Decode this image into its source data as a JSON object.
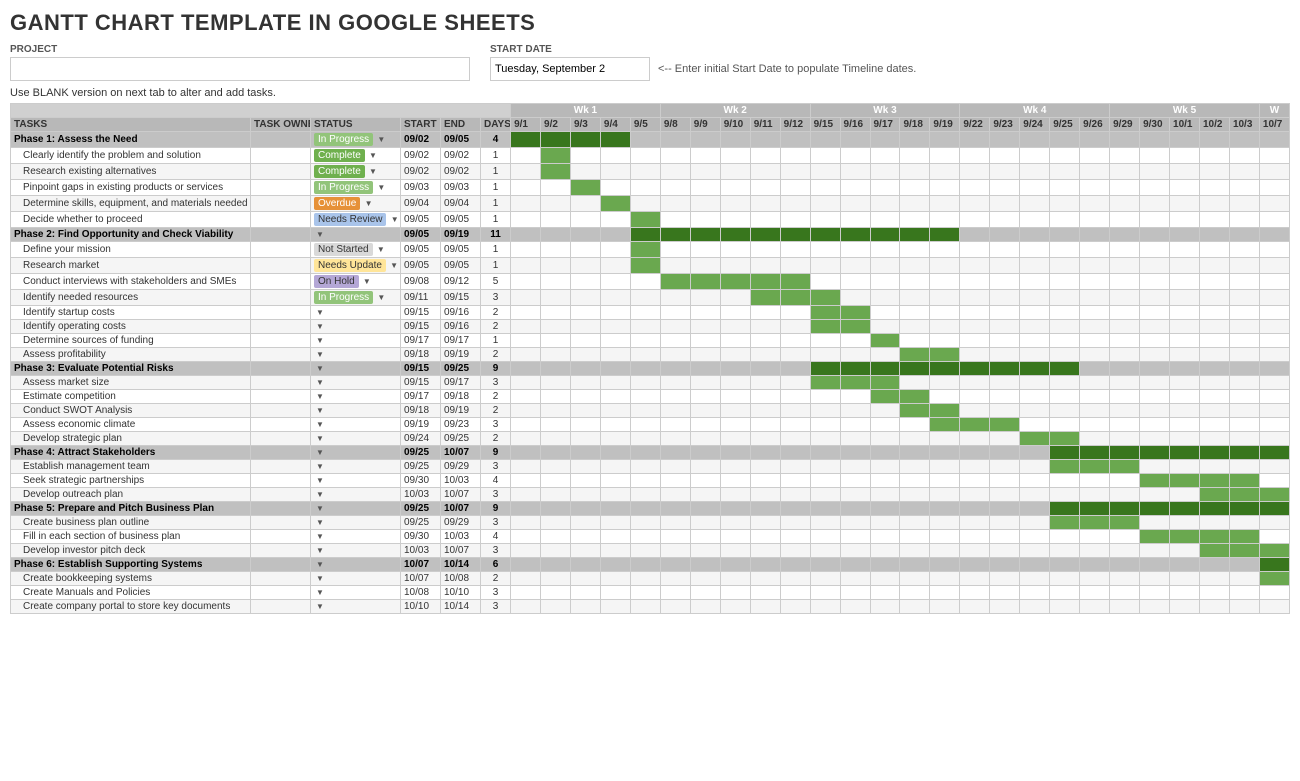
{
  "title": "GANTT CHART TEMPLATE IN GOOGLE SHEETS",
  "project_label": "PROJECT",
  "project_value": "",
  "start_date_label": "START DATE",
  "start_date_value": "Tuesday, September 2",
  "start_date_hint": "<-- Enter initial Start Date to populate Timeline dates.",
  "blank_note": "Use BLANK version on next tab to alter and add tasks.",
  "col_headers": {
    "tasks": "TASKS",
    "task_owner": "TASK OWNER",
    "status": "STATUS",
    "start": "START",
    "end": "END",
    "days": "DAYS"
  },
  "weeks": [
    "Wk 1",
    "Wk 2",
    "Wk 3",
    "Wk 4",
    "Wk 5",
    "W"
  ],
  "days": [
    "9/1",
    "9/2",
    "9/3",
    "9/4",
    "9/5",
    "9/8",
    "9/9",
    "9/10",
    "9/11",
    "9/12",
    "9/15",
    "9/16",
    "9/17",
    "9/18",
    "9/19",
    "9/22",
    "9/23",
    "9/24",
    "9/25",
    "9/26",
    "9/29",
    "9/30",
    "10/1",
    "10/2",
    "10/3",
    "10/7"
  ],
  "rows": [
    {
      "type": "phase",
      "task": "Phase 1: Assess the Need",
      "owner": "",
      "status": "In Progress",
      "status_class": "status-in-progress",
      "start": "09/02",
      "end": "09/05",
      "days": "4",
      "bars": [
        1,
        1,
        1,
        1,
        0,
        0,
        0,
        0,
        0,
        0,
        0,
        0,
        0,
        0,
        0,
        0,
        0,
        0,
        0,
        0,
        0,
        0,
        0,
        0,
        0,
        0
      ]
    },
    {
      "type": "task",
      "task": "Clearly identify the problem and solution",
      "owner": "",
      "status": "Complete",
      "status_class": "status-complete",
      "start": "09/02",
      "end": "09/02",
      "days": "1",
      "bars": [
        0,
        1,
        0,
        0,
        0,
        0,
        0,
        0,
        0,
        0,
        0,
        0,
        0,
        0,
        0,
        0,
        0,
        0,
        0,
        0,
        0,
        0,
        0,
        0,
        0,
        0
      ]
    },
    {
      "type": "task",
      "task": "Research existing alternatives",
      "owner": "",
      "status": "Complete",
      "status_class": "status-complete",
      "start": "09/02",
      "end": "09/02",
      "days": "1",
      "bars": [
        0,
        1,
        0,
        0,
        0,
        0,
        0,
        0,
        0,
        0,
        0,
        0,
        0,
        0,
        0,
        0,
        0,
        0,
        0,
        0,
        0,
        0,
        0,
        0,
        0,
        0
      ]
    },
    {
      "type": "task",
      "task": "Pinpoint gaps in existing products or services",
      "owner": "",
      "status": "In Progress",
      "status_class": "status-in-progress",
      "start": "09/03",
      "end": "09/03",
      "days": "1",
      "bars": [
        0,
        0,
        1,
        0,
        0,
        0,
        0,
        0,
        0,
        0,
        0,
        0,
        0,
        0,
        0,
        0,
        0,
        0,
        0,
        0,
        0,
        0,
        0,
        0,
        0,
        0
      ]
    },
    {
      "type": "task",
      "task": "Determine skills, equipment, and materials needed",
      "owner": "",
      "status": "Overdue",
      "status_class": "status-overdue",
      "start": "09/04",
      "end": "09/04",
      "days": "1",
      "bars": [
        0,
        0,
        0,
        1,
        0,
        0,
        0,
        0,
        0,
        0,
        0,
        0,
        0,
        0,
        0,
        0,
        0,
        0,
        0,
        0,
        0,
        0,
        0,
        0,
        0,
        0
      ]
    },
    {
      "type": "task",
      "task": "Decide whether to proceed",
      "owner": "",
      "status": "Needs Review",
      "status_class": "status-needs-review",
      "start": "09/05",
      "end": "09/05",
      "days": "1",
      "bars": [
        0,
        0,
        0,
        0,
        1,
        0,
        0,
        0,
        0,
        0,
        0,
        0,
        0,
        0,
        0,
        0,
        0,
        0,
        0,
        0,
        0,
        0,
        0,
        0,
        0,
        0
      ]
    },
    {
      "type": "phase",
      "task": "Phase 2: Find Opportunity and Check Viability",
      "owner": "",
      "status": "",
      "status_class": "",
      "start": "09/05",
      "end": "09/19",
      "days": "11",
      "bars": [
        0,
        0,
        0,
        0,
        1,
        1,
        1,
        1,
        1,
        1,
        1,
        1,
        1,
        1,
        1,
        0,
        0,
        0,
        0,
        0,
        0,
        0,
        0,
        0,
        0,
        0
      ]
    },
    {
      "type": "task",
      "task": "Define your mission",
      "owner": "",
      "status": "Not Started",
      "status_class": "status-not-started",
      "start": "09/05",
      "end": "09/05",
      "days": "1",
      "bars": [
        0,
        0,
        0,
        0,
        1,
        0,
        0,
        0,
        0,
        0,
        0,
        0,
        0,
        0,
        0,
        0,
        0,
        0,
        0,
        0,
        0,
        0,
        0,
        0,
        0,
        0
      ]
    },
    {
      "type": "task",
      "task": "Research market",
      "owner": "",
      "status": "Needs Update",
      "status_class": "status-needs-update",
      "start": "09/05",
      "end": "09/05",
      "days": "1",
      "bars": [
        0,
        0,
        0,
        0,
        1,
        0,
        0,
        0,
        0,
        0,
        0,
        0,
        0,
        0,
        0,
        0,
        0,
        0,
        0,
        0,
        0,
        0,
        0,
        0,
        0,
        0
      ]
    },
    {
      "type": "task",
      "task": "Conduct interviews with stakeholders and SMEs",
      "owner": "",
      "status": "On Hold",
      "status_class": "status-on-hold",
      "start": "09/08",
      "end": "09/12",
      "days": "5",
      "bars": [
        0,
        0,
        0,
        0,
        0,
        1,
        1,
        1,
        1,
        1,
        0,
        0,
        0,
        0,
        0,
        0,
        0,
        0,
        0,
        0,
        0,
        0,
        0,
        0,
        0,
        0
      ]
    },
    {
      "type": "task",
      "task": "Identify needed resources",
      "owner": "",
      "status": "In Progress",
      "status_class": "status-in-progress",
      "start": "09/11",
      "end": "09/15",
      "days": "3",
      "bars": [
        0,
        0,
        0,
        0,
        0,
        0,
        0,
        0,
        1,
        1,
        1,
        0,
        0,
        0,
        0,
        0,
        0,
        0,
        0,
        0,
        0,
        0,
        0,
        0,
        0,
        0
      ]
    },
    {
      "type": "task",
      "task": "Identify startup costs",
      "owner": "",
      "status": "",
      "status_class": "",
      "start": "09/15",
      "end": "09/16",
      "days": "2",
      "bars": [
        0,
        0,
        0,
        0,
        0,
        0,
        0,
        0,
        0,
        0,
        1,
        1,
        0,
        0,
        0,
        0,
        0,
        0,
        0,
        0,
        0,
        0,
        0,
        0,
        0,
        0
      ]
    },
    {
      "type": "task",
      "task": "Identify operating costs",
      "owner": "",
      "status": "",
      "status_class": "",
      "start": "09/15",
      "end": "09/16",
      "days": "2",
      "bars": [
        0,
        0,
        0,
        0,
        0,
        0,
        0,
        0,
        0,
        0,
        1,
        1,
        0,
        0,
        0,
        0,
        0,
        0,
        0,
        0,
        0,
        0,
        0,
        0,
        0,
        0
      ]
    },
    {
      "type": "task",
      "task": "Determine sources of funding",
      "owner": "",
      "status": "",
      "status_class": "",
      "start": "09/17",
      "end": "09/17",
      "days": "1",
      "bars": [
        0,
        0,
        0,
        0,
        0,
        0,
        0,
        0,
        0,
        0,
        0,
        0,
        1,
        0,
        0,
        0,
        0,
        0,
        0,
        0,
        0,
        0,
        0,
        0,
        0,
        0
      ]
    },
    {
      "type": "task",
      "task": "Assess profitability",
      "owner": "",
      "status": "",
      "status_class": "",
      "start": "09/18",
      "end": "09/19",
      "days": "2",
      "bars": [
        0,
        0,
        0,
        0,
        0,
        0,
        0,
        0,
        0,
        0,
        0,
        0,
        0,
        1,
        1,
        0,
        0,
        0,
        0,
        0,
        0,
        0,
        0,
        0,
        0,
        0
      ]
    },
    {
      "type": "phase",
      "task": "Phase 3: Evaluate Potential Risks",
      "owner": "",
      "status": "",
      "status_class": "",
      "start": "09/15",
      "end": "09/25",
      "days": "9",
      "bars": [
        0,
        0,
        0,
        0,
        0,
        0,
        0,
        0,
        0,
        0,
        1,
        1,
        1,
        1,
        1,
        1,
        1,
        1,
        1,
        0,
        0,
        0,
        0,
        0,
        0,
        0
      ]
    },
    {
      "type": "task",
      "task": "Assess market size",
      "owner": "",
      "status": "",
      "status_class": "",
      "start": "09/15",
      "end": "09/17",
      "days": "3",
      "bars": [
        0,
        0,
        0,
        0,
        0,
        0,
        0,
        0,
        0,
        0,
        1,
        1,
        1,
        0,
        0,
        0,
        0,
        0,
        0,
        0,
        0,
        0,
        0,
        0,
        0,
        0
      ]
    },
    {
      "type": "task",
      "task": "Estimate competition",
      "owner": "",
      "status": "",
      "status_class": "",
      "start": "09/17",
      "end": "09/18",
      "days": "2",
      "bars": [
        0,
        0,
        0,
        0,
        0,
        0,
        0,
        0,
        0,
        0,
        0,
        0,
        1,
        1,
        0,
        0,
        0,
        0,
        0,
        0,
        0,
        0,
        0,
        0,
        0,
        0
      ]
    },
    {
      "type": "task",
      "task": "Conduct SWOT Analysis",
      "owner": "",
      "status": "",
      "status_class": "",
      "start": "09/18",
      "end": "09/19",
      "days": "2",
      "bars": [
        0,
        0,
        0,
        0,
        0,
        0,
        0,
        0,
        0,
        0,
        0,
        0,
        0,
        1,
        1,
        0,
        0,
        0,
        0,
        0,
        0,
        0,
        0,
        0,
        0,
        0
      ]
    },
    {
      "type": "task",
      "task": "Assess economic climate",
      "owner": "",
      "status": "",
      "status_class": "",
      "start": "09/19",
      "end": "09/23",
      "days": "3",
      "bars": [
        0,
        0,
        0,
        0,
        0,
        0,
        0,
        0,
        0,
        0,
        0,
        0,
        0,
        0,
        1,
        1,
        1,
        0,
        0,
        0,
        0,
        0,
        0,
        0,
        0,
        0
      ]
    },
    {
      "type": "task",
      "task": "Develop strategic plan",
      "owner": "",
      "status": "",
      "status_class": "",
      "start": "09/24",
      "end": "09/25",
      "days": "2",
      "bars": [
        0,
        0,
        0,
        0,
        0,
        0,
        0,
        0,
        0,
        0,
        0,
        0,
        0,
        0,
        0,
        0,
        0,
        1,
        1,
        0,
        0,
        0,
        0,
        0,
        0,
        0
      ]
    },
    {
      "type": "phase",
      "task": "Phase 4: Attract Stakeholders",
      "owner": "",
      "status": "",
      "status_class": "",
      "start": "09/25",
      "end": "10/07",
      "days": "9",
      "bars": [
        0,
        0,
        0,
        0,
        0,
        0,
        0,
        0,
        0,
        0,
        0,
        0,
        0,
        0,
        0,
        0,
        0,
        0,
        1,
        1,
        1,
        1,
        1,
        1,
        1,
        1
      ]
    },
    {
      "type": "task",
      "task": "Establish management team",
      "owner": "",
      "status": "",
      "status_class": "",
      "start": "09/25",
      "end": "09/29",
      "days": "3",
      "bars": [
        0,
        0,
        0,
        0,
        0,
        0,
        0,
        0,
        0,
        0,
        0,
        0,
        0,
        0,
        0,
        0,
        0,
        0,
        1,
        1,
        1,
        0,
        0,
        0,
        0,
        0
      ]
    },
    {
      "type": "task",
      "task": "Seek strategic partnerships",
      "owner": "",
      "status": "",
      "status_class": "",
      "start": "09/30",
      "end": "10/03",
      "days": "4",
      "bars": [
        0,
        0,
        0,
        0,
        0,
        0,
        0,
        0,
        0,
        0,
        0,
        0,
        0,
        0,
        0,
        0,
        0,
        0,
        0,
        0,
        0,
        1,
        1,
        1,
        1,
        0
      ]
    },
    {
      "type": "task",
      "task": "Develop outreach plan",
      "owner": "",
      "status": "",
      "status_class": "",
      "start": "10/03",
      "end": "10/07",
      "days": "3",
      "bars": [
        0,
        0,
        0,
        0,
        0,
        0,
        0,
        0,
        0,
        0,
        0,
        0,
        0,
        0,
        0,
        0,
        0,
        0,
        0,
        0,
        0,
        0,
        0,
        1,
        1,
        1
      ]
    },
    {
      "type": "phase",
      "task": "Phase 5: Prepare and Pitch Business Plan",
      "owner": "",
      "status": "",
      "status_class": "",
      "start": "09/25",
      "end": "10/07",
      "days": "9",
      "bars": [
        0,
        0,
        0,
        0,
        0,
        0,
        0,
        0,
        0,
        0,
        0,
        0,
        0,
        0,
        0,
        0,
        0,
        0,
        1,
        1,
        1,
        1,
        1,
        1,
        1,
        1
      ]
    },
    {
      "type": "task",
      "task": "Create business plan outline",
      "owner": "",
      "status": "",
      "status_class": "",
      "start": "09/25",
      "end": "09/29",
      "days": "3",
      "bars": [
        0,
        0,
        0,
        0,
        0,
        0,
        0,
        0,
        0,
        0,
        0,
        0,
        0,
        0,
        0,
        0,
        0,
        0,
        1,
        1,
        1,
        0,
        0,
        0,
        0,
        0
      ]
    },
    {
      "type": "task",
      "task": "Fill in each section of business plan",
      "owner": "",
      "status": "",
      "status_class": "",
      "start": "09/30",
      "end": "10/03",
      "days": "4",
      "bars": [
        0,
        0,
        0,
        0,
        0,
        0,
        0,
        0,
        0,
        0,
        0,
        0,
        0,
        0,
        0,
        0,
        0,
        0,
        0,
        0,
        0,
        1,
        1,
        1,
        1,
        0
      ]
    },
    {
      "type": "task",
      "task": "Develop investor pitch deck",
      "owner": "",
      "status": "",
      "status_class": "",
      "start": "10/03",
      "end": "10/07",
      "days": "3",
      "bars": [
        0,
        0,
        0,
        0,
        0,
        0,
        0,
        0,
        0,
        0,
        0,
        0,
        0,
        0,
        0,
        0,
        0,
        0,
        0,
        0,
        0,
        0,
        0,
        1,
        1,
        1
      ]
    },
    {
      "type": "phase",
      "task": "Phase 6: Establish Supporting Systems",
      "owner": "",
      "status": "",
      "status_class": "",
      "start": "10/07",
      "end": "10/14",
      "days": "6",
      "bars": [
        0,
        0,
        0,
        0,
        0,
        0,
        0,
        0,
        0,
        0,
        0,
        0,
        0,
        0,
        0,
        0,
        0,
        0,
        0,
        0,
        0,
        0,
        0,
        0,
        0,
        1
      ]
    },
    {
      "type": "task",
      "task": "Create bookkeeping systems",
      "owner": "",
      "status": "",
      "status_class": "",
      "start": "10/07",
      "end": "10/08",
      "days": "2",
      "bars": [
        0,
        0,
        0,
        0,
        0,
        0,
        0,
        0,
        0,
        0,
        0,
        0,
        0,
        0,
        0,
        0,
        0,
        0,
        0,
        0,
        0,
        0,
        0,
        0,
        0,
        1
      ]
    },
    {
      "type": "task",
      "task": "Create Manuals and Policies",
      "owner": "",
      "status": "",
      "status_class": "",
      "start": "10/08",
      "end": "10/10",
      "days": "3",
      "bars": [
        0,
        0,
        0,
        0,
        0,
        0,
        0,
        0,
        0,
        0,
        0,
        0,
        0,
        0,
        0,
        0,
        0,
        0,
        0,
        0,
        0,
        0,
        0,
        0,
        0,
        0
      ]
    },
    {
      "type": "task",
      "task": "Create company portal to store key documents",
      "owner": "",
      "status": "",
      "status_class": "",
      "start": "10/10",
      "end": "10/14",
      "days": "3",
      "bars": [
        0,
        0,
        0,
        0,
        0,
        0,
        0,
        0,
        0,
        0,
        0,
        0,
        0,
        0,
        0,
        0,
        0,
        0,
        0,
        0,
        0,
        0,
        0,
        0,
        0,
        0
      ]
    }
  ]
}
